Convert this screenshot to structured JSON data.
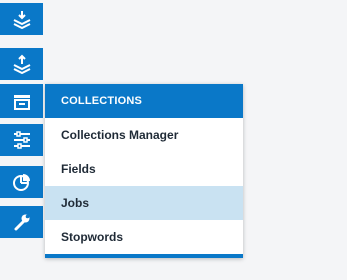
{
  "colors": {
    "accent": "#0a78c8",
    "selected_bg": "#c9e2f2",
    "page_bg": "#f4f5f7"
  },
  "sidebar": {
    "items": [
      {
        "icon": "layers-down-icon"
      },
      {
        "icon": "layers-up-icon"
      },
      {
        "icon": "collections-icon",
        "active": true
      },
      {
        "icon": "sliders-icon"
      },
      {
        "icon": "pie-chart-icon"
      },
      {
        "icon": "wrench-icon"
      }
    ]
  },
  "flyout": {
    "header": "COLLECTIONS",
    "items": [
      {
        "label": "Collections Manager"
      },
      {
        "label": "Fields"
      },
      {
        "label": "Jobs",
        "selected": true
      },
      {
        "label": "Stopwords"
      }
    ]
  }
}
